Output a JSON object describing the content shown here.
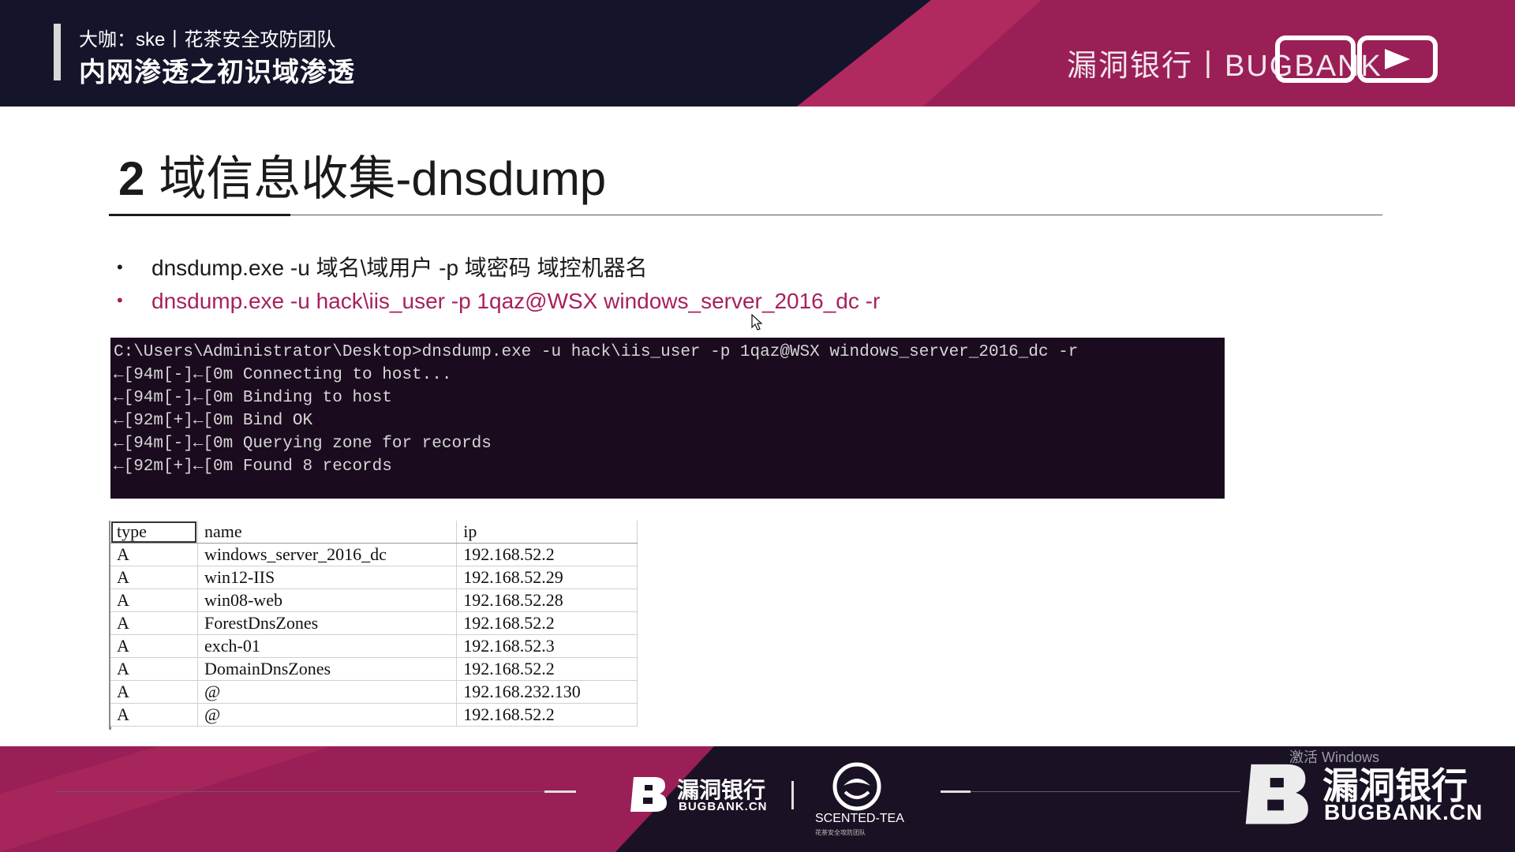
{
  "header": {
    "speaker": "大咖：ske丨花茶安全攻防团队",
    "course_title": "内网渗透之初识域渗透",
    "brand": "漏洞银行丨BUGBANK",
    "brand_logo_icon": "bilibili-logo-icon"
  },
  "slide": {
    "number": "2",
    "title": "域信息收集-dnsdump",
    "bullets": [
      "dnsdump.exe -u 域名\\域用户 -p 域密码 域控机器名",
      "dnsdump.exe -u hack\\iis_user -p 1qaz@WSX windows_server_2016_dc -r"
    ],
    "bullet_glyph": "•",
    "cursor_icon": "mouse-pointer-icon"
  },
  "terminal": {
    "lines": [
      "C:\\Users\\Administrator\\Desktop>dnsdump.exe -u hack\\iis_user -p 1qaz@WSX windows_server_2016_dc -r",
      "←[94m[-]←[0m Connecting to host...",
      "←[94m[-]←[0m Binding to host",
      "←[92m[+]←[0m Bind OK",
      "←[94m[-]←[0m Querying zone for records",
      "←[92m[+]←[0m Found 8 records"
    ]
  },
  "records": {
    "columns": [
      "type",
      "name",
      "ip"
    ],
    "rows": [
      [
        "A",
        "windows_server_2016_dc",
        "192.168.52.2"
      ],
      [
        "A",
        "win12-IIS",
        "192.168.52.29"
      ],
      [
        "A",
        "win08-web",
        "192.168.52.28"
      ],
      [
        "A",
        "ForestDnsZones",
        "192.168.52.2"
      ],
      [
        "A",
        "exch-01",
        "192.168.52.3"
      ],
      [
        "A",
        "DomainDnsZones",
        "192.168.52.2"
      ],
      [
        "A",
        "@",
        "192.168.232.130"
      ],
      [
        "A",
        "@",
        "192.168.52.2"
      ]
    ]
  },
  "footer": {
    "logo_cn": "漏洞银行",
    "logo_en": "BUGBANK.CN",
    "partner_name": "SCENTED-TEA",
    "partner_sub": "花茶安全攻防团队",
    "activate_text": "激活 Windows",
    "big_logo_cn": "漏洞银行",
    "big_logo_en": "BUGBANK.CN"
  },
  "colors": {
    "accent_magenta": "#a8205e",
    "header_bg": "#14142a",
    "terminal_bg": "#1a0b1e"
  }
}
